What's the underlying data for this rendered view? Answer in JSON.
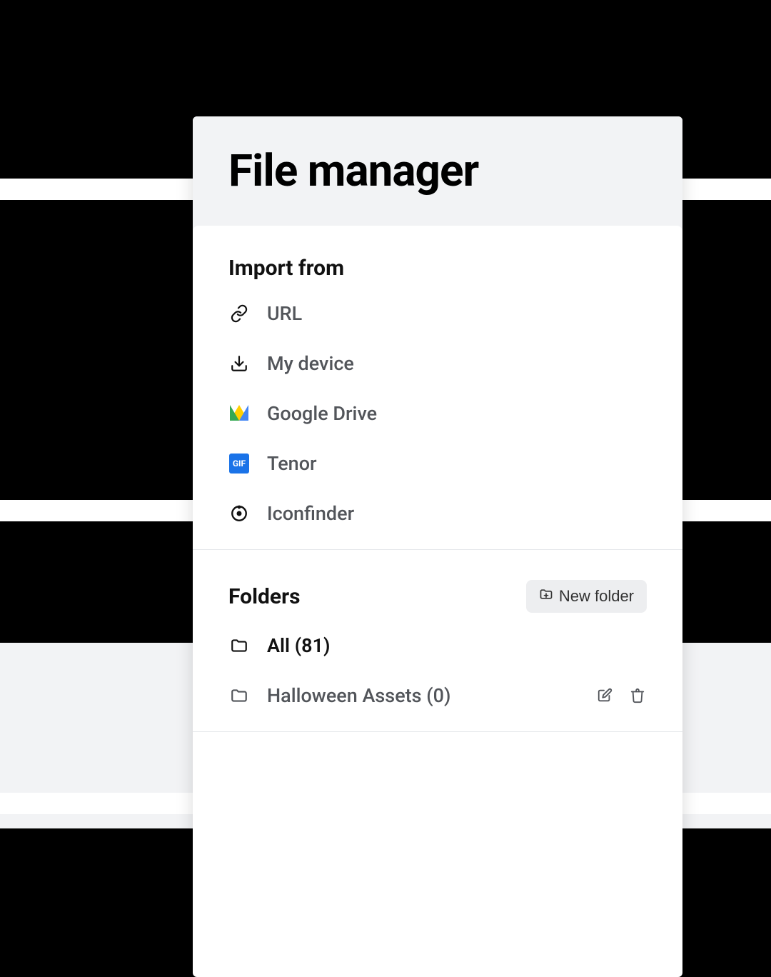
{
  "panel": {
    "title": "File manager"
  },
  "import": {
    "heading": "Import from",
    "items": [
      {
        "label": "URL",
        "icon": "link-icon"
      },
      {
        "label": "My device",
        "icon": "download-icon"
      },
      {
        "label": "Google Drive",
        "icon": "google-drive-icon"
      },
      {
        "label": "Tenor",
        "icon": "tenor-icon",
        "badge_text": "GIF"
      },
      {
        "label": "Iconfinder",
        "icon": "iconfinder-icon"
      }
    ]
  },
  "folders": {
    "heading": "Folders",
    "new_button": "New folder",
    "items": [
      {
        "name": "All",
        "count": 81,
        "display": "All (81)",
        "actions": false
      },
      {
        "name": "Halloween Assets",
        "count": 0,
        "display": "Halloween Assets (0)",
        "actions": true
      }
    ]
  }
}
